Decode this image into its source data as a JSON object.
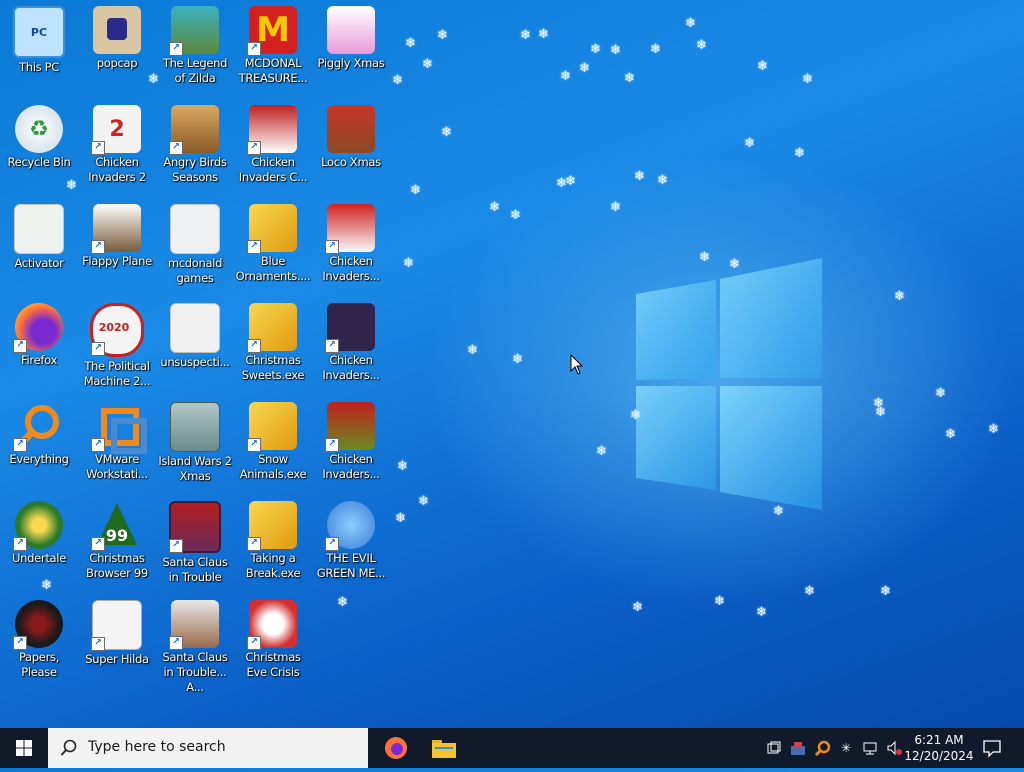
{
  "desktop": {
    "icons": [
      {
        "label": "This PC",
        "color": "#3a8fd6",
        "glyph": "PC"
      },
      {
        "label": "popcap",
        "color": "#d8c7a2",
        "glyph": ""
      },
      {
        "label": "The Legend of Zilda",
        "color": "#5c8a3a",
        "glyph": ""
      },
      {
        "label": "MCDONAL TREASURE...",
        "color": "#d42020",
        "glyph": "M"
      },
      {
        "label": "Piggly Xmas",
        "color": "#e89ad8",
        "glyph": ""
      },
      {
        "label": "Recycle Bin",
        "color": "#d9e6ef",
        "glyph": "♻"
      },
      {
        "label": "Chicken Invaders 2",
        "color": "#f2f2f2",
        "glyph": "2"
      },
      {
        "label": "Angry Birds Seasons",
        "color": "#b58a48",
        "glyph": ""
      },
      {
        "label": "Chicken Invaders C...",
        "color": "#c02020",
        "glyph": ""
      },
      {
        "label": "Loco Xmas",
        "color": "#8a4a24",
        "glyph": ""
      },
      {
        "label": "Activator",
        "color": "#eef2ee",
        "glyph": ""
      },
      {
        "label": "Flappy Plane",
        "color": "#7a5a3a",
        "glyph": ""
      },
      {
        "label": "mcdonald games",
        "color": "#eef0f2",
        "glyph": ""
      },
      {
        "label": "Blue Ornaments....",
        "color": "#f4c430",
        "glyph": ""
      },
      {
        "label": "Chicken Invaders...",
        "color": "#e8e8e8",
        "glyph": ""
      },
      {
        "label": "Firefox",
        "color": "#ff7139",
        "glyph": ""
      },
      {
        "label": "The Political Machine 2...",
        "color": "#f4f4f4",
        "glyph": "2020"
      },
      {
        "label": "unsuspecti...",
        "color": "#f0f0f0",
        "glyph": ""
      },
      {
        "label": "Christmas Sweets.exe",
        "color": "#f4c430",
        "glyph": ""
      },
      {
        "label": "Chicken Invaders...",
        "color": "#30244a",
        "glyph": ""
      },
      {
        "label": "Everything",
        "color": "#f08a20",
        "glyph": ""
      },
      {
        "label": "VMware Workstati...",
        "color": "#4a4a4a",
        "glyph": ""
      },
      {
        "label": "Island Wars 2 Xmas",
        "color": "#8fa9a8",
        "glyph": ""
      },
      {
        "label": "Snow Animals.exe",
        "color": "#f4c430",
        "glyph": ""
      },
      {
        "label": "Chicken Invaders...",
        "color": "#6a8a20",
        "glyph": ""
      },
      {
        "label": "Undertale",
        "color": "#2a7a2a",
        "glyph": ""
      },
      {
        "label": "Christmas Browser 99",
        "color": "#1f6a1f",
        "glyph": "99"
      },
      {
        "label": "Santa Claus in Trouble",
        "color": "#6a2a5a",
        "glyph": ""
      },
      {
        "label": "Taking a Break.exe",
        "color": "#f4c430",
        "glyph": ""
      },
      {
        "label": "THE EVIL GREEN ME...",
        "color": "#3a7ad6",
        "glyph": ""
      },
      {
        "label": "Papers, Please",
        "color": "#1a1a1a",
        "glyph": ""
      },
      {
        "label": "Super Hilda",
        "color": "#f4f4f4",
        "glyph": ""
      },
      {
        "label": "Santa Claus in Trouble... A...",
        "color": "#9a6a4a",
        "glyph": ""
      },
      {
        "label": "Christmas Eve Crisis",
        "color": "#d43030",
        "glyph": ""
      }
    ]
  },
  "taskbar": {
    "search_placeholder": "Type here to search",
    "pinned": [
      {
        "name": "Firefox",
        "icon": "firefox-icon",
        "color": "#ff7139"
      },
      {
        "name": "File Explorer",
        "icon": "folder-icon",
        "color": "#f4c430"
      }
    ],
    "clock_time": "6:21 AM",
    "clock_date": "12/20/2024"
  },
  "colors": {
    "taskbar": "#101a2a",
    "accent": "#0b79d6"
  }
}
